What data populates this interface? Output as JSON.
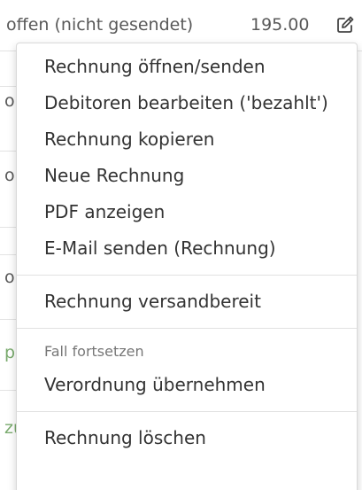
{
  "row": {
    "status": "offen (nicht gesendet)",
    "amount": "195.00",
    "edit_icon": "pencil-square-icon"
  },
  "peek_rows": [
    {
      "char": "o",
      "color": "#595959"
    },
    {
      "char": "o",
      "color": "#595959"
    },
    {
      "char": "o",
      "color": "#595959"
    },
    {
      "char": "p",
      "color": "#7aab6e"
    },
    {
      "char": "zu",
      "color": "#7aab6e"
    }
  ],
  "menu": {
    "group1": [
      "Rechnung öffnen/senden",
      "Debitoren bearbeiten ('bezahlt')",
      "Rechnung kopieren",
      "Neue Rechnung",
      "PDF anzeigen",
      "E-Mail senden (Rechnung)"
    ],
    "group2": [
      "Rechnung versandbereit"
    ],
    "header": "Fall fortsetzen",
    "group3": [
      "Verordnung übernehmen"
    ],
    "group4": [
      "Rechnung löschen"
    ]
  }
}
